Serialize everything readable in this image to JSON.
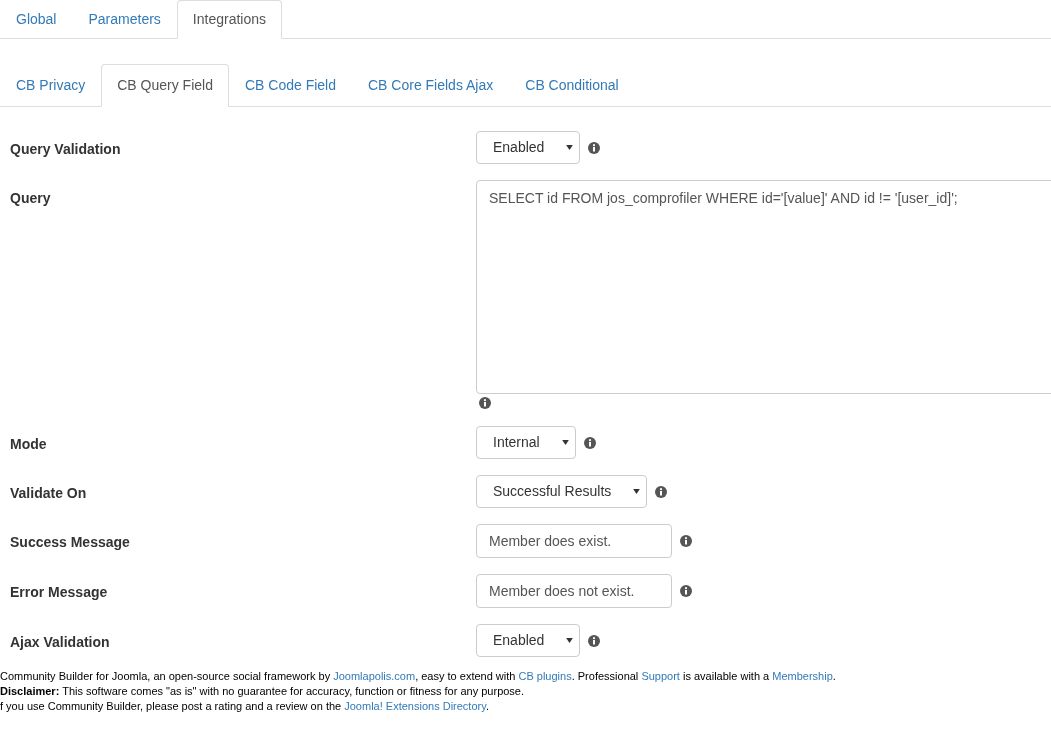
{
  "top_tabs": [
    {
      "label": "Global",
      "selected": false
    },
    {
      "label": "Parameters",
      "selected": false
    },
    {
      "label": "Integrations",
      "selected": true
    }
  ],
  "sub_tabs": [
    {
      "label": "CB Privacy",
      "selected": false
    },
    {
      "label": "CB Query Field",
      "selected": true
    },
    {
      "label": "CB Code Field",
      "selected": false
    },
    {
      "label": "CB Core Fields Ajax",
      "selected": false
    },
    {
      "label": "CB Conditional",
      "selected": false
    }
  ],
  "fields": [
    {
      "label": "Query Validation",
      "kind": "select",
      "value": "Enabled"
    },
    {
      "label": "Query",
      "kind": "textarea",
      "value": "SELECT id FROM jos_comprofiler WHERE id='[value]' AND id != '[user_id]';"
    },
    {
      "label": "Mode",
      "kind": "select",
      "value": "Internal"
    },
    {
      "label": "Validate On",
      "kind": "select",
      "value": "Successful Results"
    },
    {
      "label": "Success Message",
      "kind": "text",
      "value": "Member does exist."
    },
    {
      "label": "Error Message",
      "kind": "text",
      "value": "Member does not exist."
    },
    {
      "label": "Ajax Validation",
      "kind": "select",
      "value": "Enabled"
    }
  ],
  "footer": [
    [
      {
        "text": "Community Builder for Joomla, an open-source social framework by ",
        "kind": "plain"
      },
      {
        "text": "Joomlapolis.com",
        "kind": "link"
      },
      {
        "text": ", easy to extend with ",
        "kind": "plain"
      },
      {
        "text": "CB plugins",
        "kind": "link"
      },
      {
        "text": ". Professional ",
        "kind": "plain"
      },
      {
        "text": "Support",
        "kind": "link"
      },
      {
        "text": " is available with a ",
        "kind": "plain"
      },
      {
        "text": "Membership",
        "kind": "link"
      },
      {
        "text": ".",
        "kind": "plain"
      }
    ],
    [
      {
        "text": "**Disclaimer:** This software comes \"as is\" with no guarantee for accuracy, function or fitness for any purpose.",
        "kind": "plain"
      }
    ],
    [
      {
        "text": "f you use Community Builder, please post a rating and a review on the ",
        "kind": "plain"
      },
      {
        "text": "Joomla! Extensions Directory",
        "kind": "link"
      },
      {
        "text": ".",
        "kind": "plain"
      }
    ]
  ]
}
